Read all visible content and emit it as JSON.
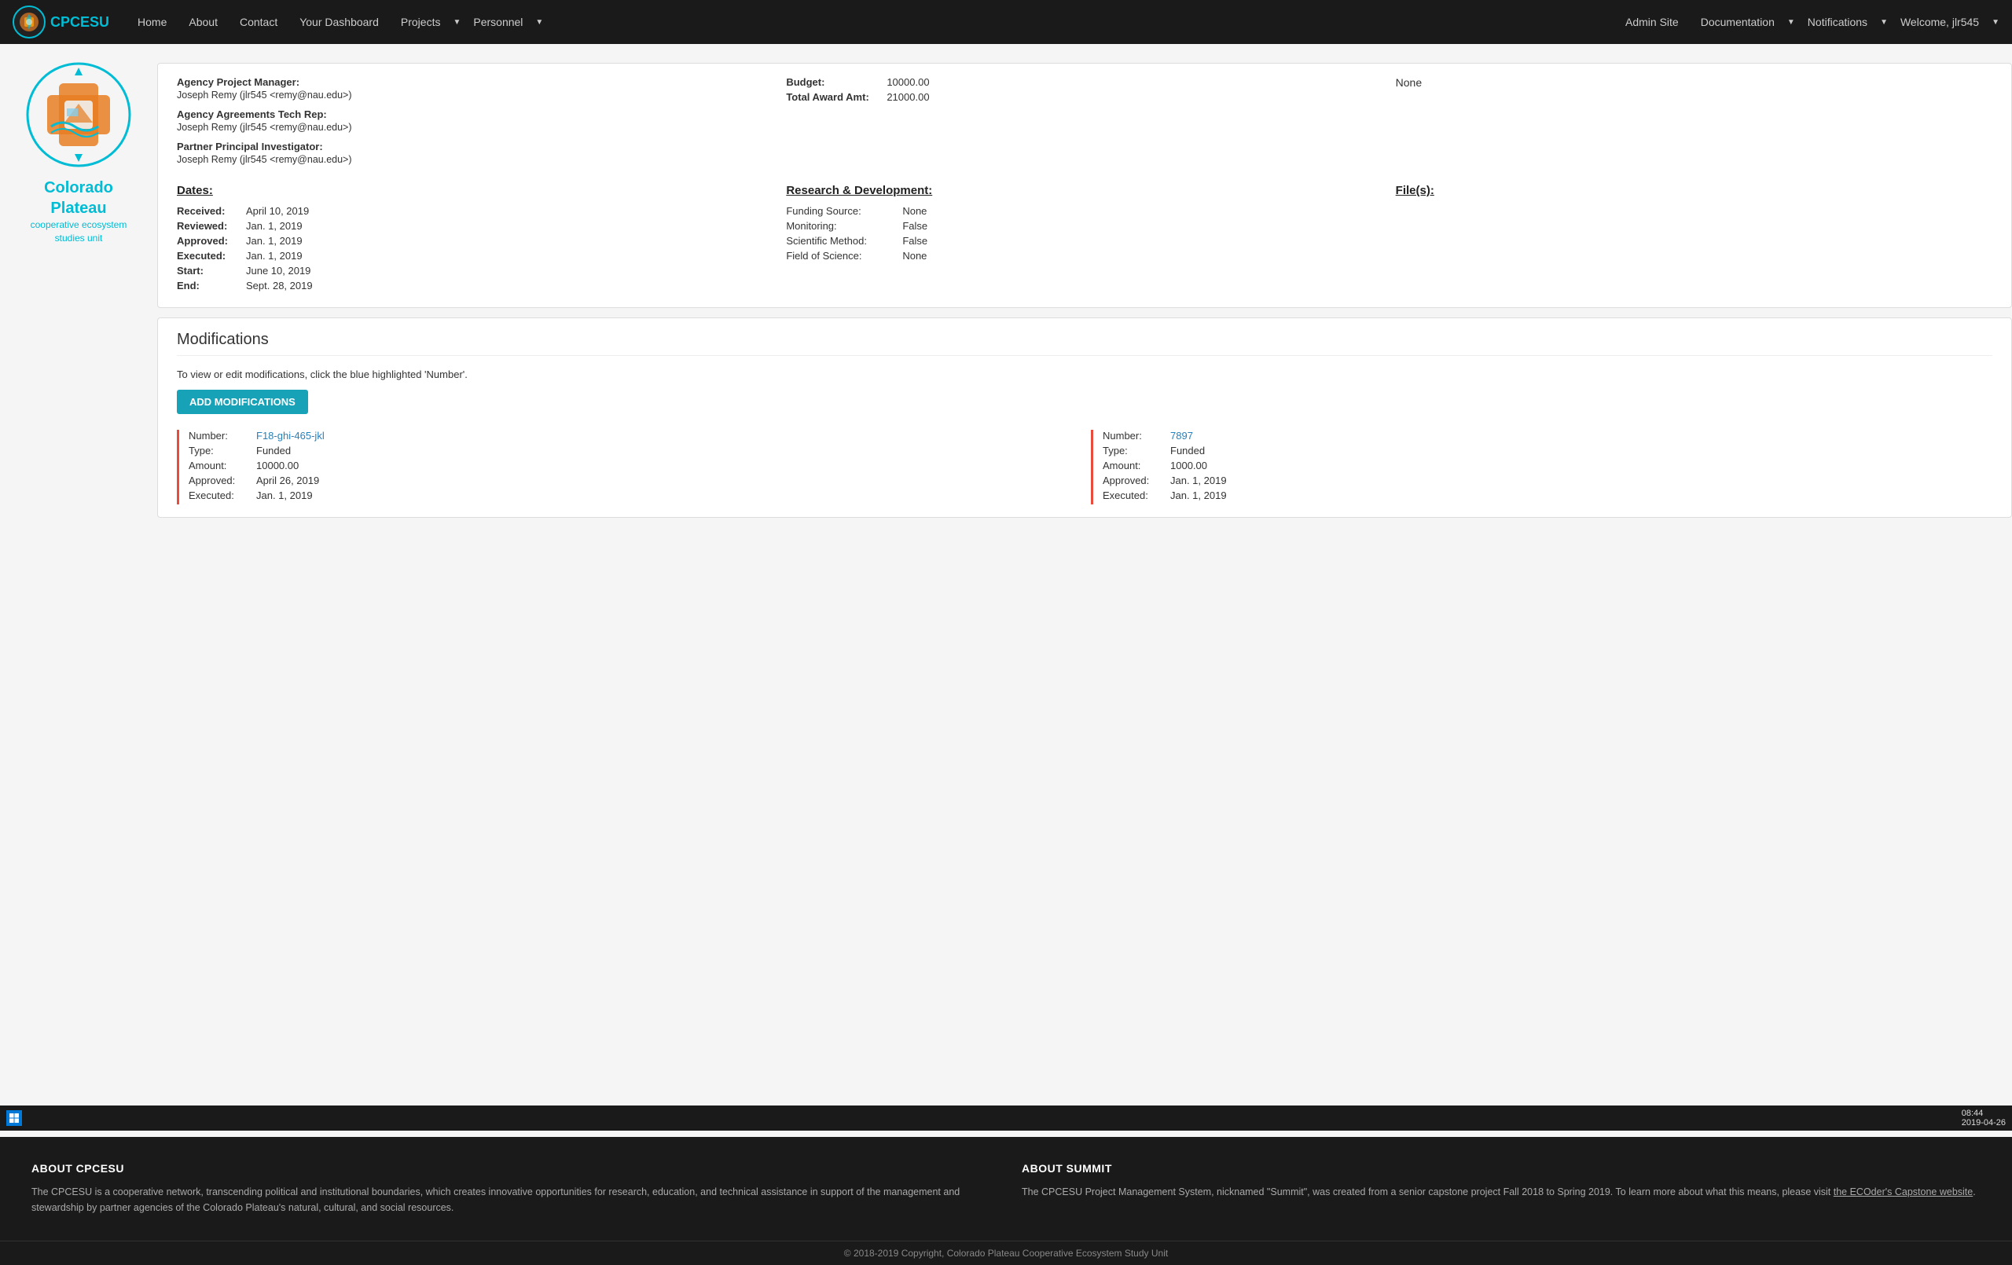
{
  "nav": {
    "logo_text": "CPCESU",
    "links": [
      {
        "label": "Home",
        "id": "home"
      },
      {
        "label": "About",
        "id": "about"
      },
      {
        "label": "Contact",
        "id": "contact"
      },
      {
        "label": "Your Dashboard",
        "id": "dashboard"
      },
      {
        "label": "Projects",
        "id": "projects",
        "dropdown": true
      },
      {
        "label": "Personnel",
        "id": "personnel",
        "dropdown": true
      }
    ],
    "right_links": [
      {
        "label": "Admin Site",
        "id": "admin"
      },
      {
        "label": "Documentation",
        "id": "documentation",
        "dropdown": true
      },
      {
        "label": "Notifications",
        "id": "notifications",
        "dropdown": true
      },
      {
        "label": "Welcome, jlr545",
        "id": "user",
        "dropdown": true
      }
    ]
  },
  "sidebar": {
    "org_name_line1": "Colorado",
    "org_name_line2": "Plateau",
    "org_sub": "cooperative ecosystem studies unit"
  },
  "project": {
    "persons": [
      {
        "label": "Agency Project Manager:",
        "value": "Joseph Remy (jlr545 <remy@nau.edu>)"
      },
      {
        "label": "Agency Agreements Tech Rep:",
        "value": "Joseph Remy (jlr545 <remy@nau.edu>)"
      },
      {
        "label": "Partner Principal Investigator:",
        "value": "Joseph Remy (jlr545 <remy@nau.edu>)"
      }
    ],
    "budget": {
      "budget_label": "Budget:",
      "budget_value": "10000.00",
      "total_award_label": "Total Award Amt:",
      "total_award_value": "21000.00"
    },
    "files_label": "None",
    "dates": {
      "title": "Dates:",
      "received_label": "Received:",
      "received_value": "April 10, 2019",
      "reviewed_label": "Reviewed:",
      "reviewed_value": "Jan. 1, 2019",
      "approved_label": "Approved:",
      "approved_value": "Jan. 1, 2019",
      "executed_label": "Executed:",
      "executed_value": "Jan. 1, 2019",
      "start_label": "Start:",
      "start_value": "June 10, 2019",
      "end_label": "End:",
      "end_value": "Sept. 28, 2019"
    },
    "rd": {
      "title": "Research & Development:",
      "funding_source_label": "Funding Source:",
      "funding_source_value": "None",
      "monitoring_label": "Monitoring:",
      "monitoring_value": "False",
      "scientific_method_label": "Scientific Method:",
      "scientific_method_value": "False",
      "field_of_science_label": "Field of Science:",
      "field_of_science_value": "None"
    },
    "files": {
      "title": "File(s):"
    }
  },
  "modifications": {
    "title": "Modifications",
    "instructions": "To view or edit modifications, click the blue highlighted 'Number'.",
    "add_button_label": "ADD MODIFICATIONS",
    "entries": [
      {
        "number_label": "Number:",
        "number_value": "F18-ghi-465-jkl",
        "number_link": true,
        "type_label": "Type:",
        "type_value": "Funded",
        "amount_label": "Amount:",
        "amount_value": "10000.00",
        "approved_label": "Approved:",
        "approved_value": "April 26, 2019",
        "executed_label": "Executed:",
        "executed_value": "Jan. 1, 2019"
      },
      {
        "number_label": "Number:",
        "number_value": "7897",
        "number_link": true,
        "type_label": "Type:",
        "type_value": "Funded",
        "amount_label": "Amount:",
        "amount_value": "1000.00",
        "approved_label": "Approved:",
        "approved_value": "Jan. 1, 2019",
        "executed_label": "Executed:",
        "executed_value": "Jan. 1, 2019"
      }
    ]
  },
  "footer": {
    "about_cpcesu_title": "ABOUT CPCESU",
    "about_cpcesu_text": "The CPCESU is a cooperative network, transcending political and institutional boundaries, which creates innovative opportunities for research, education, and technical assistance in support of the management and stewardship by partner agencies of the Colorado Plateau's natural, cultural, and social resources.",
    "about_summit_title": "ABOUT SUMMIT",
    "about_summit_text": "The CPCESU Project Management System, nicknamed \"Summit\", was created from a senior capstone project Fall 2018 to Spring 2019. To learn more about what this means, please visit ",
    "about_summit_link_text": "the ECOder's Capstone website",
    "copyright": "© 2018-2019 Copyright, Colorado Plateau Cooperative Ecosystem Study Unit"
  },
  "taskbar": {
    "time": "08:44",
    "date": "2019-04-26"
  }
}
